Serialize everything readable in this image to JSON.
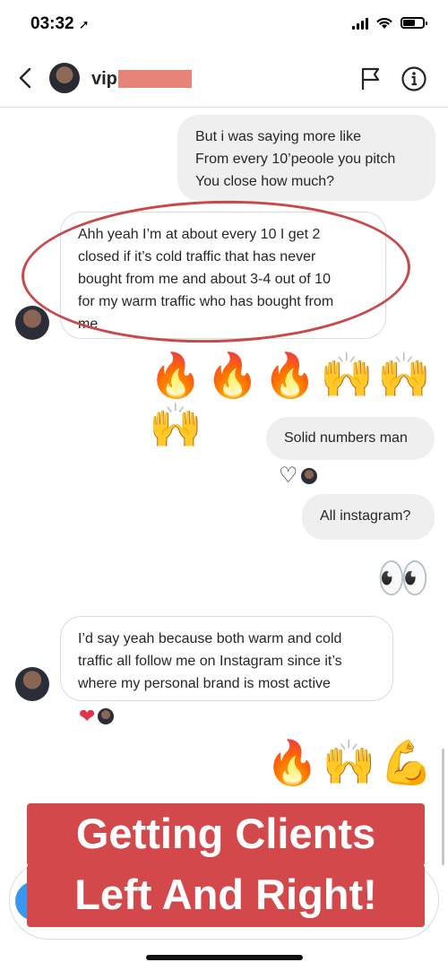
{
  "status": {
    "time": "03:32",
    "battery_level": 0.6
  },
  "header": {
    "username": "vip",
    "flag_icon": "flag-icon",
    "info_icon": "info-icon",
    "back_icon": "chevron-left-icon"
  },
  "messages": [
    {
      "side": "out",
      "lines": [
        "But i was saying more like",
        "From every 10’peoole you pitch",
        "You close how much?"
      ]
    },
    {
      "side": "in",
      "lines": [
        "Ahh yeah I’m at about every 10 I get 2",
        "closed if it’s cold traffic that has never",
        "bought from me and about 3-4 out of 10",
        "for my warm traffic who has bought from",
        "me"
      ]
    },
    {
      "side": "out",
      "emoji": "🔥🔥🔥🙌🙌🙌"
    },
    {
      "side": "out",
      "lines": [
        "Solid numbers man"
      ]
    },
    {
      "side": "out",
      "lines": [
        "All instagram?"
      ]
    },
    {
      "side": "out",
      "emoji": "👀"
    },
    {
      "side": "in",
      "lines": [
        "I’d say yeah because both warm and cold",
        "traffic all follow me on Instagram since it’s",
        "where my personal brand is most active"
      ]
    },
    {
      "side": "out",
      "emoji": "🔥🙌💪"
    }
  ],
  "reactions": {
    "solid": "♡",
    "active": "❤"
  },
  "banner": {
    "line1": "Getting Clients",
    "line2": "Left And Right!"
  },
  "colors": {
    "banner": "#d3494b",
    "annotation": "#c9484a",
    "redaction": "#e88379"
  }
}
